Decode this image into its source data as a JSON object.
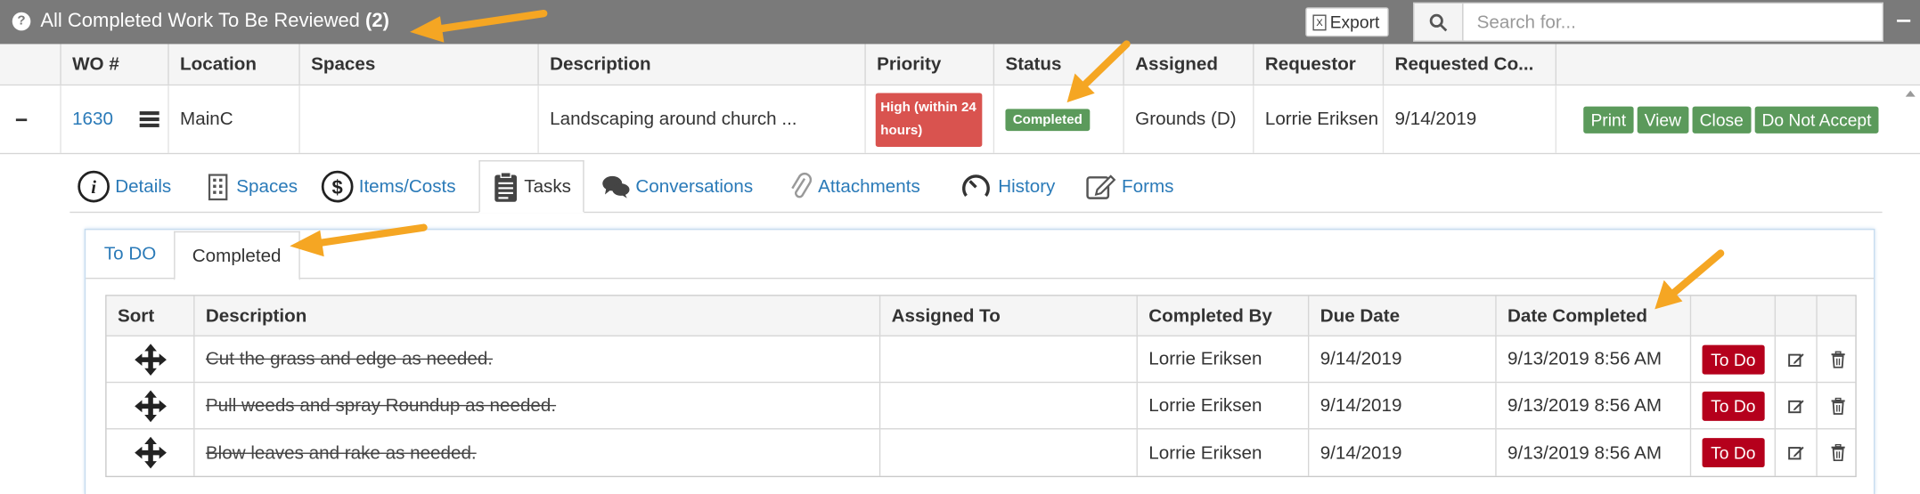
{
  "header": {
    "title": "All Completed Work To Be Reviewed",
    "count": "(2)",
    "export_label": "Export",
    "search_placeholder": "Search for..."
  },
  "grid": {
    "columns": [
      "WO #",
      "Location",
      "Spaces",
      "Description",
      "Priority",
      "Status",
      "Assigned",
      "Requestor",
      "Requested Co..."
    ],
    "row": {
      "wo": "1630",
      "location": "MainC",
      "spaces": "",
      "description": "Landscaping around church ...",
      "priority": "High (within 24 hours)",
      "status": "Completed",
      "assigned": "Grounds (D)",
      "requestor": "Lorrie Eriksen",
      "requested_completion": "9/14/2019",
      "actions": [
        "Print",
        "View",
        "Close",
        "Do Not Accept"
      ]
    }
  },
  "detail_tabs": [
    {
      "label": "Details",
      "icon": "info-icon"
    },
    {
      "label": "Spaces",
      "icon": "building-icon"
    },
    {
      "label": "Items/Costs",
      "icon": "dollar-icon"
    },
    {
      "label": "Tasks",
      "icon": "clipboard-icon",
      "active": true
    },
    {
      "label": "Conversations",
      "icon": "chat-icon"
    },
    {
      "label": "Attachments",
      "icon": "paperclip-icon"
    },
    {
      "label": "History",
      "icon": "history-icon"
    },
    {
      "label": "Forms",
      "icon": "edit-form-icon"
    }
  ],
  "task_tabs": [
    {
      "label": "To DO"
    },
    {
      "label": "Completed",
      "active": true
    }
  ],
  "tasks": {
    "columns": [
      "Sort",
      "Description",
      "Assigned To",
      "Completed By",
      "Due Date",
      "Date Completed"
    ],
    "rows": [
      {
        "description": "Cut the grass and edge as needed.",
        "assigned_to": "",
        "completed_by": "Lorrie Eriksen",
        "due_date": "9/14/2019",
        "date_completed": "9/13/2019 8:56 AM",
        "action": "To Do"
      },
      {
        "description": "Pull weeds and spray Roundup as needed.",
        "assigned_to": "",
        "completed_by": "Lorrie Eriksen",
        "due_date": "9/14/2019",
        "date_completed": "9/13/2019 8:56 AM",
        "action": "To Do"
      },
      {
        "description": "Blow leaves and rake as needed.",
        "assigned_to": "",
        "completed_by": "Lorrie Eriksen",
        "due_date": "9/14/2019",
        "date_completed": "9/13/2019 8:56 AM",
        "action": "To Do"
      }
    ]
  },
  "colors": {
    "header_bg": "#7a7a7a",
    "link": "#2a7ab8",
    "success": "#5b9a5b",
    "danger": "#d9534f",
    "todo": "#b5001c",
    "arrow": "#f5a623"
  }
}
